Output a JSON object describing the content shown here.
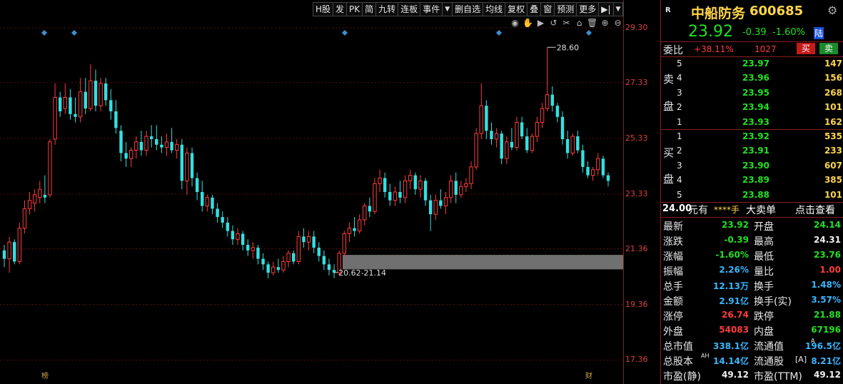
{
  "toolbar": {
    "items": [
      "H股",
      "发",
      "PK",
      "简",
      "九转",
      "连板",
      "事件",
      "▼",
      "删自选",
      "均线",
      "复权",
      "叠",
      "窗",
      "预测",
      "更多",
      "▶|",
      "▼"
    ]
  },
  "chart_tools": {
    "icons": [
      "eye-icon",
      "hand-icon",
      "play-icon",
      "undo-icon",
      "scissors-icon",
      "lock-icon",
      "delete-icon",
      "zoom-in-icon",
      "zoom-out-icon"
    ]
  },
  "chart_data": {
    "type": "candlestick",
    "price_axis_labels": [
      "29.30",
      "27.33",
      "25.33",
      "23.33",
      "21.36",
      "19.36",
      "17.36"
    ],
    "ylim": [
      16.5,
      30.3
    ],
    "max_label": "28.60",
    "min_label": "20.62-21.14",
    "bottom_markers": [
      "榜",
      "财"
    ],
    "up_color": "#ff3c3c",
    "down_color": "#33e0e0",
    "candles": [
      {
        "o": 21.3,
        "h": 21.5,
        "l": 20.7,
        "c": 21.0
      },
      {
        "o": 21.0,
        "h": 21.8,
        "l": 20.5,
        "c": 21.6
      },
      {
        "o": 21.6,
        "h": 21.7,
        "l": 20.8,
        "c": 20.9
      },
      {
        "o": 20.9,
        "h": 22.3,
        "l": 20.8,
        "c": 22.1
      },
      {
        "o": 22.1,
        "h": 23.1,
        "l": 21.9,
        "c": 22.8
      },
      {
        "o": 22.8,
        "h": 23.4,
        "l": 22.6,
        "c": 23.1
      },
      {
        "o": 23.0,
        "h": 23.5,
        "l": 22.7,
        "c": 23.3
      },
      {
        "o": 23.2,
        "h": 23.8,
        "l": 23.0,
        "c": 23.5
      },
      {
        "o": 23.3,
        "h": 24.0,
        "l": 23.0,
        "c": 23.2
      },
      {
        "o": 23.3,
        "h": 25.3,
        "l": 23.2,
        "c": 25.2
      },
      {
        "o": 25.3,
        "h": 27.3,
        "l": 25.1,
        "c": 26.8
      },
      {
        "o": 26.8,
        "h": 27.0,
        "l": 26.1,
        "c": 26.3
      },
      {
        "o": 26.4,
        "h": 27.3,
        "l": 26.2,
        "c": 26.8
      },
      {
        "o": 26.8,
        "h": 27.1,
        "l": 26.0,
        "c": 26.2
      },
      {
        "o": 26.2,
        "h": 26.8,
        "l": 25.9,
        "c": 26.1
      },
      {
        "o": 26.1,
        "h": 27.5,
        "l": 25.9,
        "c": 27.0
      },
      {
        "o": 27.0,
        "h": 27.5,
        "l": 26.2,
        "c": 26.4
      },
      {
        "o": 26.4,
        "h": 28.0,
        "l": 26.3,
        "c": 27.4
      },
      {
        "o": 27.4,
        "h": 27.8,
        "l": 26.3,
        "c": 26.5
      },
      {
        "o": 26.5,
        "h": 27.5,
        "l": 26.3,
        "c": 27.3
      },
      {
        "o": 27.3,
        "h": 27.5,
        "l": 26.5,
        "c": 26.7
      },
      {
        "o": 26.7,
        "h": 27.1,
        "l": 26.0,
        "c": 26.3
      },
      {
        "o": 26.3,
        "h": 26.7,
        "l": 25.5,
        "c": 25.7
      },
      {
        "o": 25.6,
        "h": 25.8,
        "l": 24.5,
        "c": 24.8
      },
      {
        "o": 24.8,
        "h": 25.2,
        "l": 24.3,
        "c": 24.6
      },
      {
        "o": 24.6,
        "h": 25.0,
        "l": 24.3,
        "c": 24.9
      },
      {
        "o": 24.9,
        "h": 25.4,
        "l": 24.6,
        "c": 25.2
      },
      {
        "o": 25.2,
        "h": 25.6,
        "l": 24.7,
        "c": 24.9
      },
      {
        "o": 24.9,
        "h": 25.6,
        "l": 24.7,
        "c": 25.4
      },
      {
        "o": 25.4,
        "h": 25.8,
        "l": 25.0,
        "c": 25.3
      },
      {
        "o": 25.3,
        "h": 25.8,
        "l": 24.9,
        "c": 25.1
      },
      {
        "o": 25.1,
        "h": 25.4,
        "l": 24.8,
        "c": 25.0
      },
      {
        "o": 25.0,
        "h": 25.5,
        "l": 24.7,
        "c": 25.2
      },
      {
        "o": 25.2,
        "h": 25.7,
        "l": 24.8,
        "c": 24.9
      },
      {
        "o": 24.9,
        "h": 25.3,
        "l": 24.6,
        "c": 25.1
      },
      {
        "o": 25.1,
        "h": 25.3,
        "l": 23.5,
        "c": 23.8
      },
      {
        "o": 23.8,
        "h": 25.0,
        "l": 23.3,
        "c": 24.8
      },
      {
        "o": 24.8,
        "h": 25.0,
        "l": 23.6,
        "c": 23.9
      },
      {
        "o": 23.9,
        "h": 24.1,
        "l": 23.1,
        "c": 23.4
      },
      {
        "o": 23.4,
        "h": 23.8,
        "l": 22.7,
        "c": 22.9
      },
      {
        "o": 22.9,
        "h": 23.3,
        "l": 22.7,
        "c": 23.2
      },
      {
        "o": 23.2,
        "h": 23.3,
        "l": 22.6,
        "c": 22.8
      },
      {
        "o": 22.8,
        "h": 23.0,
        "l": 22.3,
        "c": 22.5
      },
      {
        "o": 22.5,
        "h": 22.7,
        "l": 22.1,
        "c": 22.3
      },
      {
        "o": 22.3,
        "h": 22.5,
        "l": 21.8,
        "c": 22.0
      },
      {
        "o": 22.0,
        "h": 22.2,
        "l": 21.5,
        "c": 21.7
      },
      {
        "o": 21.7,
        "h": 22.1,
        "l": 21.5,
        "c": 21.9
      },
      {
        "o": 21.9,
        "h": 22.0,
        "l": 21.3,
        "c": 21.5
      },
      {
        "o": 21.5,
        "h": 21.7,
        "l": 21.1,
        "c": 21.3
      },
      {
        "o": 21.3,
        "h": 21.6,
        "l": 21.0,
        "c": 21.4
      },
      {
        "o": 21.4,
        "h": 21.5,
        "l": 20.8,
        "c": 21.0
      },
      {
        "o": 21.0,
        "h": 21.2,
        "l": 20.6,
        "c": 20.8
      },
      {
        "o": 20.8,
        "h": 20.9,
        "l": 20.3,
        "c": 20.5
      },
      {
        "o": 20.5,
        "h": 20.9,
        "l": 20.4,
        "c": 20.7
      },
      {
        "o": 20.7,
        "h": 21.0,
        "l": 20.5,
        "c": 20.6
      },
      {
        "o": 20.6,
        "h": 21.1,
        "l": 20.5,
        "c": 20.9
      },
      {
        "o": 20.9,
        "h": 21.3,
        "l": 20.7,
        "c": 21.2
      },
      {
        "o": 21.2,
        "h": 21.3,
        "l": 20.8,
        "c": 20.9
      },
      {
        "o": 20.9,
        "h": 22.0,
        "l": 20.8,
        "c": 21.8
      },
      {
        "o": 21.8,
        "h": 22.1,
        "l": 21.4,
        "c": 21.6
      },
      {
        "o": 21.6,
        "h": 22.0,
        "l": 21.3,
        "c": 21.8
      },
      {
        "o": 21.8,
        "h": 22.0,
        "l": 21.2,
        "c": 21.4
      },
      {
        "o": 21.4,
        "h": 21.6,
        "l": 20.9,
        "c": 21.1
      },
      {
        "o": 21.1,
        "h": 21.3,
        "l": 20.6,
        "c": 20.8
      },
      {
        "o": 20.8,
        "h": 21.0,
        "l": 20.4,
        "c": 20.6
      },
      {
        "o": 20.6,
        "h": 20.8,
        "l": 20.3,
        "c": 20.5
      },
      {
        "o": 20.5,
        "h": 21.3,
        "l": 20.4,
        "c": 21.2
      },
      {
        "o": 21.2,
        "h": 22.0,
        "l": 21.1,
        "c": 21.9
      },
      {
        "o": 21.9,
        "h": 22.3,
        "l": 21.6,
        "c": 22.1
      },
      {
        "o": 22.1,
        "h": 22.5,
        "l": 21.8,
        "c": 22.0
      },
      {
        "o": 22.0,
        "h": 22.6,
        "l": 21.9,
        "c": 22.4
      },
      {
        "o": 22.4,
        "h": 23.0,
        "l": 22.2,
        "c": 22.9
      },
      {
        "o": 22.9,
        "h": 23.2,
        "l": 22.5,
        "c": 22.7
      },
      {
        "o": 22.7,
        "h": 23.9,
        "l": 22.6,
        "c": 23.7
      },
      {
        "o": 23.7,
        "h": 24.2,
        "l": 23.4,
        "c": 23.9
      },
      {
        "o": 23.9,
        "h": 24.1,
        "l": 23.2,
        "c": 23.4
      },
      {
        "o": 23.4,
        "h": 23.7,
        "l": 22.9,
        "c": 23.1
      },
      {
        "o": 23.1,
        "h": 23.6,
        "l": 22.9,
        "c": 23.4
      },
      {
        "o": 23.4,
        "h": 23.8,
        "l": 23.0,
        "c": 23.2
      },
      {
        "o": 23.2,
        "h": 24.0,
        "l": 23.0,
        "c": 23.8
      },
      {
        "o": 23.8,
        "h": 24.2,
        "l": 23.5,
        "c": 24.0
      },
      {
        "o": 24.0,
        "h": 24.1,
        "l": 23.3,
        "c": 23.5
      },
      {
        "o": 23.5,
        "h": 24.0,
        "l": 23.2,
        "c": 23.8
      },
      {
        "o": 23.8,
        "h": 23.9,
        "l": 22.9,
        "c": 23.1
      },
      {
        "o": 23.1,
        "h": 23.3,
        "l": 22.0,
        "c": 22.6
      },
      {
        "o": 22.6,
        "h": 23.3,
        "l": 22.4,
        "c": 23.1
      },
      {
        "o": 23.1,
        "h": 23.5,
        "l": 22.8,
        "c": 22.9
      },
      {
        "o": 22.9,
        "h": 23.4,
        "l": 22.6,
        "c": 23.2
      },
      {
        "o": 23.2,
        "h": 24.0,
        "l": 23.0,
        "c": 23.8
      },
      {
        "o": 23.8,
        "h": 24.1,
        "l": 23.0,
        "c": 23.3
      },
      {
        "o": 23.3,
        "h": 23.8,
        "l": 23.2,
        "c": 23.6
      },
      {
        "o": 23.6,
        "h": 23.9,
        "l": 23.4,
        "c": 23.7
      },
      {
        "o": 23.7,
        "h": 24.5,
        "l": 23.5,
        "c": 24.3
      },
      {
        "o": 24.3,
        "h": 25.7,
        "l": 24.2,
        "c": 25.5
      },
      {
        "o": 25.5,
        "h": 27.3,
        "l": 25.3,
        "c": 26.5
      },
      {
        "o": 26.5,
        "h": 26.7,
        "l": 25.3,
        "c": 25.6
      },
      {
        "o": 25.6,
        "h": 25.9,
        "l": 25.1,
        "c": 25.3
      },
      {
        "o": 25.3,
        "h": 25.7,
        "l": 25.0,
        "c": 25.5
      },
      {
        "o": 25.5,
        "h": 25.6,
        "l": 24.4,
        "c": 24.6
      },
      {
        "o": 24.6,
        "h": 25.4,
        "l": 24.4,
        "c": 25.2
      },
      {
        "o": 25.2,
        "h": 25.7,
        "l": 24.9,
        "c": 25.0
      },
      {
        "o": 25.0,
        "h": 26.1,
        "l": 24.9,
        "c": 25.9
      },
      {
        "o": 25.9,
        "h": 26.1,
        "l": 25.3,
        "c": 25.4
      },
      {
        "o": 25.4,
        "h": 25.7,
        "l": 24.8,
        "c": 24.9
      },
      {
        "o": 24.9,
        "h": 25.5,
        "l": 24.8,
        "c": 25.4
      },
      {
        "o": 25.4,
        "h": 26.1,
        "l": 25.2,
        "c": 25.9
      },
      {
        "o": 25.9,
        "h": 26.6,
        "l": 25.7,
        "c": 26.4
      },
      {
        "o": 26.4,
        "h": 28.6,
        "l": 26.3,
        "c": 26.9
      },
      {
        "o": 26.9,
        "h": 27.2,
        "l": 26.3,
        "c": 26.5
      },
      {
        "o": 26.5,
        "h": 26.6,
        "l": 25.9,
        "c": 26.1
      },
      {
        "o": 26.1,
        "h": 26.3,
        "l": 25.1,
        "c": 25.3
      },
      {
        "o": 25.3,
        "h": 25.6,
        "l": 24.6,
        "c": 24.8
      },
      {
        "o": 24.8,
        "h": 25.5,
        "l": 24.7,
        "c": 25.4
      },
      {
        "o": 25.4,
        "h": 25.6,
        "l": 24.8,
        "c": 24.9
      },
      {
        "o": 24.9,
        "h": 25.1,
        "l": 24.1,
        "c": 24.3
      },
      {
        "o": 24.3,
        "h": 24.5,
        "l": 23.9,
        "c": 24.0
      },
      {
        "o": 24.0,
        "h": 24.3,
        "l": 23.8,
        "c": 24.2
      },
      {
        "o": 24.2,
        "h": 24.8,
        "l": 24.0,
        "c": 24.6
      },
      {
        "o": 24.6,
        "h": 24.7,
        "l": 23.9,
        "c": 24.0
      },
      {
        "o": 24.0,
        "h": 24.1,
        "l": 23.6,
        "c": 23.8
      }
    ]
  },
  "panel": {
    "badge": "R",
    "name": "中船防务",
    "code": "600685",
    "price": "23.92",
    "change": "-0.39",
    "change_pct": "-1.60%",
    "market": "陆",
    "weibi_label": "委比",
    "weibi_pct": "+38.11%",
    "weibi_num": "1027",
    "buy_btn": "买",
    "sell_btn": "卖",
    "sell_side_chars": [
      "卖",
      "盘"
    ],
    "buy_side_chars": [
      "买",
      "盘"
    ],
    "asks": [
      {
        "idx": "5",
        "price": "23.97",
        "vol": "147"
      },
      {
        "idx": "4",
        "price": "23.96",
        "vol": "156"
      },
      {
        "idx": "3",
        "price": "23.95",
        "vol": "268"
      },
      {
        "idx": "2",
        "price": "23.94",
        "vol": "101"
      },
      {
        "idx": "1",
        "price": "23.93",
        "vol": "162"
      }
    ],
    "bids": [
      {
        "idx": "1",
        "price": "23.92",
        "vol": "535"
      },
      {
        "idx": "2",
        "price": "23.91",
        "vol": "233"
      },
      {
        "idx": "3",
        "price": "23.90",
        "vol": "607"
      },
      {
        "idx": "4",
        "price": "23.89",
        "vol": "385"
      },
      {
        "idx": "5",
        "price": "23.88",
        "vol": "101"
      }
    ],
    "bigorder": {
      "price": "24.00",
      "unit": "元有",
      "stars": "****手",
      "text": "大卖单",
      "link": "点击查看"
    },
    "quotes": [
      {
        "l1": "最新",
        "v1": "23.92",
        "c1": "green",
        "l2": "开盘",
        "v2": "24.14",
        "c2": "green"
      },
      {
        "l1": "涨跌",
        "v1": "-0.39",
        "c1": "green",
        "l2": "最高",
        "v2": "24.31",
        "c2": "white"
      },
      {
        "l1": "涨幅",
        "v1": "-1.60%",
        "c1": "green",
        "l2": "最低",
        "v2": "23.76",
        "c2": "green"
      },
      {
        "l1": "振幅",
        "v1": "2.26%",
        "c1": "cyan",
        "l2": "量比",
        "v2": "1.00",
        "c2": "red"
      },
      {
        "l1": "总手",
        "v1": "12.13万",
        "c1": "cyan",
        "l2": "换手",
        "v2": "1.48%",
        "c2": "cyan"
      },
      {
        "l1": "金额",
        "v1": "2.91亿",
        "c1": "cyan",
        "l2": "换手(实)",
        "v2": "3.57%",
        "c2": "cyan"
      },
      {
        "l1": "涨停",
        "v1": "26.74",
        "c1": "red",
        "l2": "跌停",
        "v2": "21.88",
        "c2": "green"
      },
      {
        "l1": "外盘",
        "v1": "54083",
        "c1": "red",
        "l2": "内盘",
        "v2": "67196",
        "c2": "green"
      },
      {
        "l1": "总市值",
        "v1": "338.1亿",
        "c1": "cyan",
        "l2": "流通值",
        "v2": "196.5亿",
        "c2": "cyan",
        "sup2": "A"
      },
      {
        "l1": "总股本",
        "v1": "14.14亿",
        "c1": "cyan",
        "l2": "流通股",
        "v2": "8.21亿",
        "c2": "cyan",
        "sup1": "AH",
        "tag2": "[A]"
      },
      {
        "l1": "市盈(静)",
        "v1": "49.12",
        "c1": "white",
        "l2": "市盈(TTM)",
        "v2": "49.12",
        "c2": "white"
      }
    ]
  }
}
